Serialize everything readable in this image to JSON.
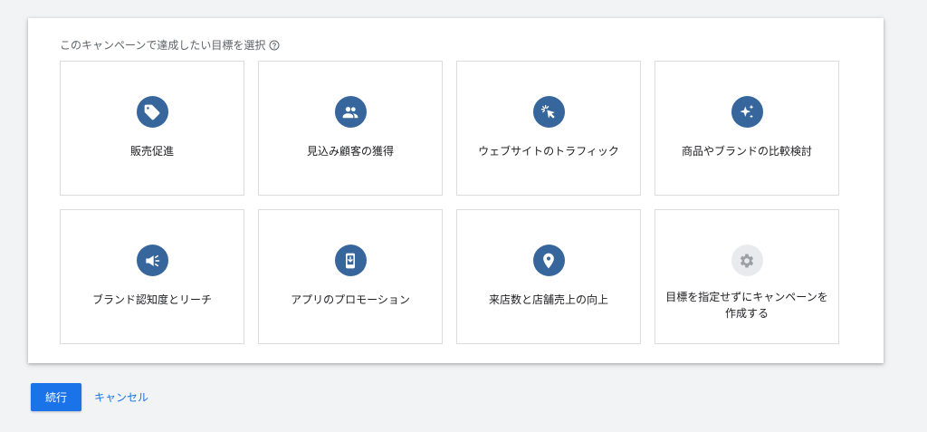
{
  "heading": {
    "text": "このキャンペーンで達成したい目標を選択",
    "help_icon": "help-circle-icon"
  },
  "goals": [
    {
      "label": "販売促進",
      "icon": "tag-icon"
    },
    {
      "label": "見込み顧客の獲得",
      "icon": "people-icon"
    },
    {
      "label": "ウェブサイトのトラフィック",
      "icon": "cursor-click-icon"
    },
    {
      "label": "商品やブランドの比較検討",
      "icon": "sparkle-icon"
    },
    {
      "label": "ブランド認知度とリーチ",
      "icon": "megaphone-icon"
    },
    {
      "label": "アプリのプロモーション",
      "icon": "mobile-download-icon"
    },
    {
      "label": "来店数と店舗売上の向上",
      "icon": "location-pin-icon"
    },
    {
      "label": "目標を指定せずにキャンペーンを作成する",
      "icon": "gear-icon"
    }
  ],
  "actions": {
    "continue_label": "続行",
    "cancel_label": "キャンセル"
  },
  "colors": {
    "icon_bg": "#37669c",
    "icon_bg_disabled": "#e8eaed",
    "primary": "#1a73e8"
  }
}
